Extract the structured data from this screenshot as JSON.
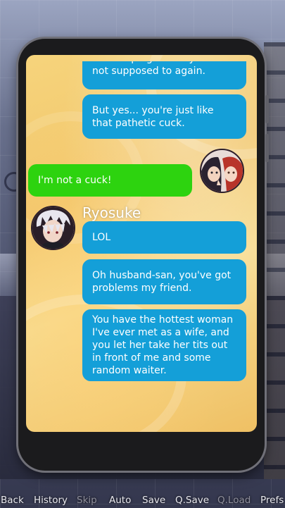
{
  "messages": [
    {
      "sender": "ryosuke",
      "text": "be snooping where you're not supposed to again."
    },
    {
      "sender": "ryosuke",
      "text": "But yes... you're just like that pathetic cuck."
    },
    {
      "sender": "player",
      "text": "I'm not a cuck!"
    },
    {
      "sender": "ryosuke",
      "name": "Ryosuke",
      "text": "LOL"
    },
    {
      "sender": "ryosuke",
      "text": "Oh husband-san, you've got problems my friend."
    },
    {
      "sender": "ryosuke",
      "text": "You have the hottest woman I've ever met as a wife, and you let her take her tits out in front of me and some random waiter."
    }
  ],
  "quick_menu": [
    {
      "label": "Back",
      "enabled": true
    },
    {
      "label": "History",
      "enabled": true
    },
    {
      "label": "Skip",
      "enabled": false
    },
    {
      "label": "Auto",
      "enabled": true
    },
    {
      "label": "Save",
      "enabled": true
    },
    {
      "label": "Q.Save",
      "enabled": true
    },
    {
      "label": "Q.Load",
      "enabled": false
    },
    {
      "label": "Prefs",
      "enabled": true
    }
  ],
  "colors": {
    "incoming_bubble": "#149fd8",
    "outgoing_bubble": "#2dd30f",
    "chat_background": "#f2c66b",
    "phone_body": "#1b1b1d"
  },
  "icons": {
    "player_avatar": "couple-selfie-avatar",
    "sender_avatar": "white-haired-man-avatar"
  }
}
